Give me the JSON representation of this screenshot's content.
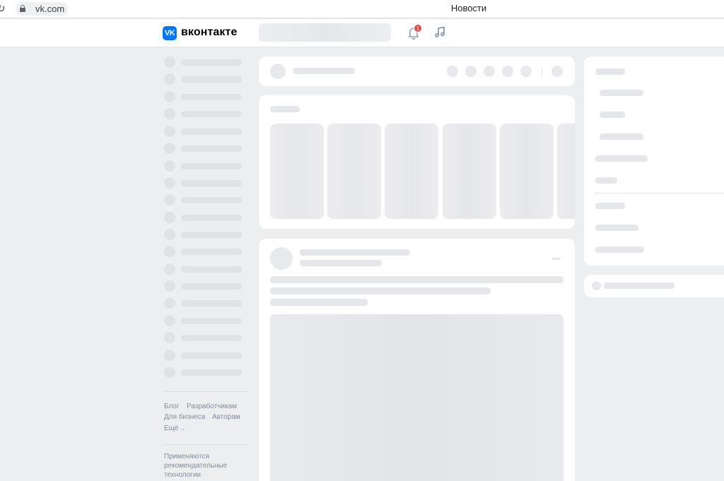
{
  "browser": {
    "url": "vk.com",
    "tab_title": "Новости"
  },
  "header": {
    "logo_mark": "VK",
    "logo_text": "вконтакте",
    "notifications_count": "1",
    "icons": [
      "vk-logo-icon",
      "bell-icon",
      "music-icon"
    ]
  },
  "left_nav": {
    "footer_links": {
      "blog": "Блог",
      "developers": "Разработчикам",
      "business": "Для бизнеса",
      "authors": "Авторам",
      "more": "Ещё"
    },
    "recommendation_note": [
      "Применяются",
      "рекомендательные",
      "технологии"
    ]
  },
  "colors": {
    "page_bg": "#edeef0",
    "card_bg": "#ffffff",
    "accent": "#0077ff",
    "badge": "#e64646",
    "skeleton": "#e6e7ea",
    "footer_text": "#818c99"
  }
}
